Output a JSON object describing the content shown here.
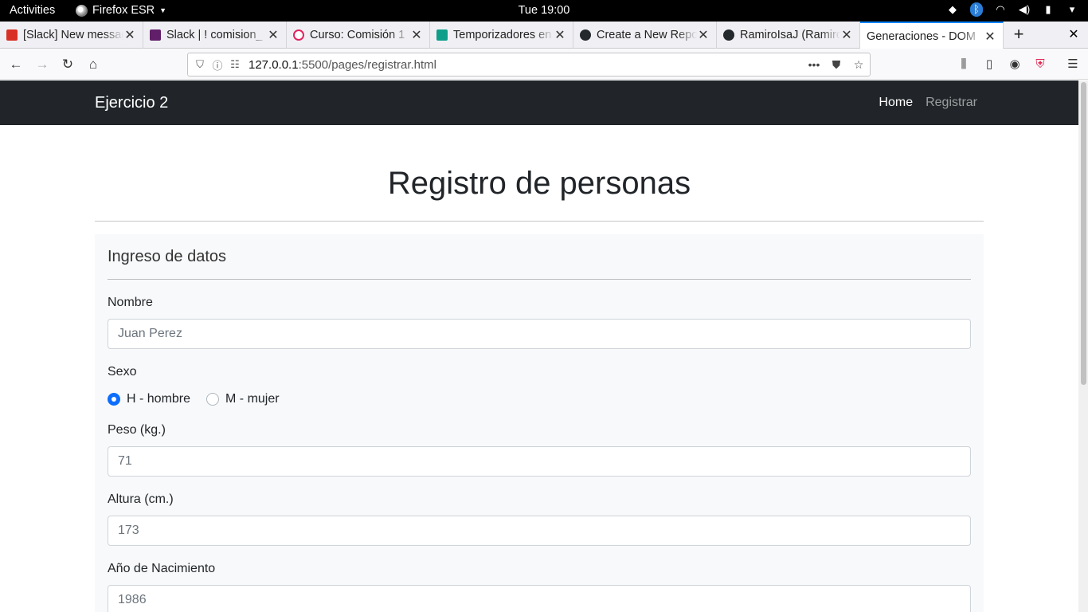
{
  "topbar": {
    "activities": "Activities",
    "app_name": "Firefox ESR",
    "clock": "Tue 19:00"
  },
  "tabs": [
    {
      "title": "[Slack] New messages",
      "favicon_color": "#d93025",
      "icon": "gmail-icon"
    },
    {
      "title": "Slack | ! comision_",
      "favicon_color": "#611f69",
      "icon": "slack-icon"
    },
    {
      "title": "Curso: Comisión 1",
      "favicon_color": "#e0245e",
      "icon": "course-icon"
    },
    {
      "title": "Temporizadores en",
      "favicon_color": "#0e9f8a",
      "icon": "site-icon"
    },
    {
      "title": "Create a New Repo",
      "favicon_color": "#24292e",
      "icon": "github-icon"
    },
    {
      "title": "RamiroIsaJ (Ramiro",
      "favicon_color": "#24292e",
      "icon": "github-icon"
    },
    {
      "title": "Generaciones - DOM",
      "favicon_color": "",
      "icon": "",
      "active": true
    }
  ],
  "urlbar": {
    "host": "127.0.0.1",
    "rest": ":5500/pages/registrar.html"
  },
  "site": {
    "brand": "Ejercicio 2",
    "nav": [
      {
        "label": "Home",
        "active": true
      },
      {
        "label": "Registrar",
        "active": false
      }
    ],
    "title": "Registro de personas",
    "card_title": "Ingreso de datos",
    "form": {
      "nombre_label": "Nombre",
      "nombre_placeholder": "Juan Perez",
      "sexo_label": "Sexo",
      "sexo_options": [
        {
          "label": "H - hombre",
          "checked": true
        },
        {
          "label": "M - mujer",
          "checked": false
        }
      ],
      "peso_label": "Peso (kg.)",
      "peso_placeholder": "71",
      "altura_label": "Altura (cm.)",
      "altura_placeholder": "173",
      "anio_label": "Año de Nacimiento",
      "anio_placeholder": "1986"
    }
  }
}
